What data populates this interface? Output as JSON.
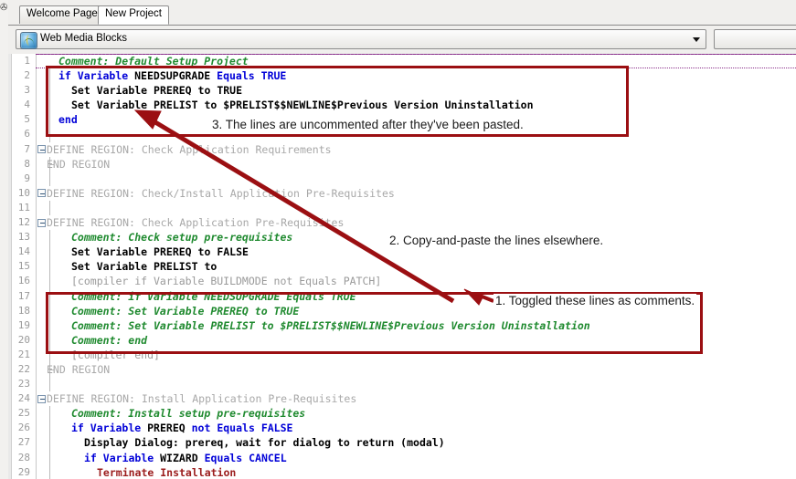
{
  "window": {
    "edge_glyph": "✇"
  },
  "tabs": [
    {
      "label": "Welcome Page",
      "active": false
    },
    {
      "label": "New Project",
      "active": true
    }
  ],
  "combo": {
    "selected": "Web Media Blocks",
    "icon": "globe-icon",
    "arrow": "chevron-down-icon"
  },
  "editor": {
    "first_line": 1,
    "last_line": 29,
    "lines": [
      {
        "n": 1,
        "fold": "none",
        "guide": "none",
        "indent": 0,
        "tokens": [
          {
            "t": "Comment: Default Setup Project",
            "c": "cmt"
          }
        ]
      },
      {
        "n": 2,
        "fold": "none",
        "guide": "bar",
        "indent": 0,
        "tokens": [
          {
            "t": "if",
            "c": "kw"
          },
          {
            "t": " ",
            "c": "plain"
          },
          {
            "t": "Variable",
            "c": "kw"
          },
          {
            "t": " ",
            "c": "plain"
          },
          {
            "t": "NEEDSUPGRADE",
            "c": "id"
          },
          {
            "t": " ",
            "c": "plain"
          },
          {
            "t": "Equals",
            "c": "kw"
          },
          {
            "t": " ",
            "c": "plain"
          },
          {
            "t": "TRUE",
            "c": "kw"
          }
        ]
      },
      {
        "n": 3,
        "fold": "none",
        "guide": "bar",
        "indent": 1,
        "tokens": [
          {
            "t": "Set",
            "c": "id"
          },
          {
            "t": " ",
            "c": "plain"
          },
          {
            "t": "Variable",
            "c": "id"
          },
          {
            "t": " ",
            "c": "plain"
          },
          {
            "t": "PREREQ",
            "c": "id"
          },
          {
            "t": " ",
            "c": "plain"
          },
          {
            "t": "to",
            "c": "id"
          },
          {
            "t": " ",
            "c": "plain"
          },
          {
            "t": "TRUE",
            "c": "id"
          }
        ]
      },
      {
        "n": 4,
        "fold": "none",
        "guide": "bar",
        "indent": 1,
        "tokens": [
          {
            "t": "Set",
            "c": "id"
          },
          {
            "t": " ",
            "c": "plain"
          },
          {
            "t": "Variable",
            "c": "id"
          },
          {
            "t": " ",
            "c": "plain"
          },
          {
            "t": "PRELIST",
            "c": "id"
          },
          {
            "t": " ",
            "c": "plain"
          },
          {
            "t": "to",
            "c": "id"
          },
          {
            "t": " ",
            "c": "plain"
          },
          {
            "t": "$PRELIST$$NEWLINE$Previous Version Uninstallation",
            "c": "id"
          }
        ]
      },
      {
        "n": 5,
        "fold": "none",
        "guide": "bar",
        "indent": 0,
        "tokens": [
          {
            "t": "end",
            "c": "kw"
          }
        ]
      },
      {
        "n": 6,
        "fold": "none",
        "guide": "bar",
        "indent": 0,
        "tokens": []
      },
      {
        "n": 7,
        "fold": "box",
        "guide": "none",
        "indent": -1,
        "tokens": [
          {
            "t": "DEFINE REGION: Check Application Requirements",
            "c": "reg"
          }
        ]
      },
      {
        "n": 8,
        "fold": "none",
        "guide": "corner",
        "indent": -1,
        "tokens": [
          {
            "t": "END REGION",
            "c": "reg"
          }
        ]
      },
      {
        "n": 9,
        "fold": "none",
        "guide": "bar",
        "indent": 0,
        "tokens": []
      },
      {
        "n": 10,
        "fold": "box",
        "guide": "none",
        "indent": -1,
        "tokens": [
          {
            "t": "DEFINE REGION: Check/Install Application Pre-Requisites",
            "c": "reg"
          }
        ]
      },
      {
        "n": 11,
        "fold": "none",
        "guide": "bar",
        "indent": 0,
        "tokens": []
      },
      {
        "n": 12,
        "fold": "box",
        "guide": "none",
        "indent": -1,
        "tokens": [
          {
            "t": "DEFINE REGION: Check Application Pre-Requisites",
            "c": "reg"
          }
        ]
      },
      {
        "n": 13,
        "fold": "none",
        "guide": "bar",
        "indent": 1,
        "tokens": [
          {
            "t": "Comment: Check setup pre-requisites",
            "c": "cmt"
          }
        ]
      },
      {
        "n": 14,
        "fold": "none",
        "guide": "bar",
        "indent": 1,
        "tokens": [
          {
            "t": "Set",
            "c": "id"
          },
          {
            "t": " ",
            "c": "plain"
          },
          {
            "t": "Variable",
            "c": "id"
          },
          {
            "t": " ",
            "c": "plain"
          },
          {
            "t": "PREREQ",
            "c": "id"
          },
          {
            "t": " ",
            "c": "plain"
          },
          {
            "t": "to",
            "c": "id"
          },
          {
            "t": " ",
            "c": "plain"
          },
          {
            "t": "FALSE",
            "c": "id"
          }
        ]
      },
      {
        "n": 15,
        "fold": "none",
        "guide": "bar",
        "indent": 1,
        "tokens": [
          {
            "t": "Set",
            "c": "id"
          },
          {
            "t": " ",
            "c": "plain"
          },
          {
            "t": "Variable",
            "c": "id"
          },
          {
            "t": " ",
            "c": "plain"
          },
          {
            "t": "PRELIST",
            "c": "id"
          },
          {
            "t": " ",
            "c": "plain"
          },
          {
            "t": "to",
            "c": "id"
          }
        ]
      },
      {
        "n": 16,
        "fold": "none",
        "guide": "bar",
        "indent": 1,
        "tokens": [
          {
            "t": "[compiler if Variable BUILDMODE not Equals PATCH]",
            "c": "dir"
          }
        ]
      },
      {
        "n": 17,
        "fold": "none",
        "guide": "bar",
        "indent": 1,
        "tokens": [
          {
            "t": "Comment: if Variable NEEDSUPGRADE Equals TRUE",
            "c": "cmt"
          }
        ]
      },
      {
        "n": 18,
        "fold": "none",
        "guide": "bar",
        "indent": 1,
        "tokens": [
          {
            "t": "Comment: Set Variable PREREQ to TRUE",
            "c": "cmt"
          }
        ]
      },
      {
        "n": 19,
        "fold": "none",
        "guide": "bar",
        "indent": 1,
        "tokens": [
          {
            "t": "Comment: Set Variable PRELIST to $PRELIST$$NEWLINE$Previous Version Uninstallation",
            "c": "cmt"
          }
        ]
      },
      {
        "n": 20,
        "fold": "none",
        "guide": "bar",
        "indent": 1,
        "tokens": [
          {
            "t": "Comment: end",
            "c": "cmt"
          }
        ]
      },
      {
        "n": 21,
        "fold": "none",
        "guide": "bar",
        "indent": 1,
        "tokens": [
          {
            "t": "[compiler end]",
            "c": "dir"
          }
        ]
      },
      {
        "n": 22,
        "fold": "none",
        "guide": "corner",
        "indent": -1,
        "tokens": [
          {
            "t": "END REGION",
            "c": "reg"
          }
        ]
      },
      {
        "n": 23,
        "fold": "none",
        "guide": "bar",
        "indent": 0,
        "tokens": []
      },
      {
        "n": 24,
        "fold": "box",
        "guide": "none",
        "indent": -1,
        "tokens": [
          {
            "t": "DEFINE REGION: Install Application Pre-Requisites",
            "c": "reg"
          }
        ]
      },
      {
        "n": 25,
        "fold": "none",
        "guide": "bar",
        "indent": 1,
        "tokens": [
          {
            "t": "Comment: Install setup pre-requisites",
            "c": "cmt"
          }
        ]
      },
      {
        "n": 26,
        "fold": "none",
        "guide": "bar",
        "indent": 1,
        "tokens": [
          {
            "t": "if",
            "c": "kw"
          },
          {
            "t": " ",
            "c": "plain"
          },
          {
            "t": "Variable",
            "c": "kw"
          },
          {
            "t": " ",
            "c": "plain"
          },
          {
            "t": "PREREQ",
            "c": "id"
          },
          {
            "t": " ",
            "c": "plain"
          },
          {
            "t": "not",
            "c": "kw"
          },
          {
            "t": " ",
            "c": "plain"
          },
          {
            "t": "Equals",
            "c": "kw"
          },
          {
            "t": " ",
            "c": "plain"
          },
          {
            "t": "FALSE",
            "c": "kw"
          }
        ]
      },
      {
        "n": 27,
        "fold": "none",
        "guide": "bar",
        "indent": 2,
        "tokens": [
          {
            "t": "Display Dialog: prereq, wait for dialog to return (modal)",
            "c": "id"
          }
        ]
      },
      {
        "n": 28,
        "fold": "none",
        "guide": "bar",
        "indent": 2,
        "tokens": [
          {
            "t": "if",
            "c": "kw"
          },
          {
            "t": " ",
            "c": "plain"
          },
          {
            "t": "Variable",
            "c": "kw"
          },
          {
            "t": " ",
            "c": "plain"
          },
          {
            "t": "WIZARD",
            "c": "id"
          },
          {
            "t": " ",
            "c": "plain"
          },
          {
            "t": "Equals",
            "c": "kw"
          },
          {
            "t": " ",
            "c": "plain"
          },
          {
            "t": "CANCEL",
            "c": "kw"
          }
        ]
      },
      {
        "n": 29,
        "fold": "none",
        "guide": "bar",
        "indent": 3,
        "tokens": [
          {
            "t": "Terminate Installation",
            "c": "err"
          }
        ]
      }
    ]
  },
  "annotations": {
    "accent_color": "#9b0f12",
    "callouts": [
      {
        "id": "callout-3",
        "text": "3. The lines are uncommented after they've been pasted."
      },
      {
        "id": "callout-2",
        "text": "2. Copy-and-paste the lines elsewhere."
      },
      {
        "id": "callout-1",
        "text": "1. Toggled these lines as comments."
      }
    ]
  }
}
